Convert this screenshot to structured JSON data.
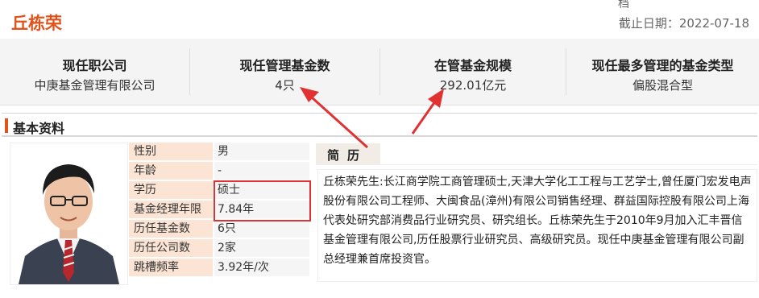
{
  "header": {
    "manager_name": "丘栋荣",
    "top_cut_text": "档",
    "cutoff_date": "截止日期：2022-07-18"
  },
  "stats": [
    {
      "title": "现任职公司",
      "value": "中庚基金管理有限公司"
    },
    {
      "title": "现任管理基金数",
      "value": "4只"
    },
    {
      "title": "在管基金规模",
      "value": "292.01亿元"
    },
    {
      "title": "现任最多管理的基金类型",
      "value": "偏股混合型"
    }
  ],
  "section": {
    "title": "基本资料"
  },
  "info": [
    {
      "key": "性别",
      "value": "男"
    },
    {
      "key": "年龄",
      "value": "-"
    },
    {
      "key": "学历",
      "value": "硕士"
    },
    {
      "key": "基金经理年限",
      "value": "7.84年"
    },
    {
      "key": "历任基金数",
      "value": "6只"
    },
    {
      "key": "历任公司数",
      "value": "2家"
    },
    {
      "key": "跳槽频率",
      "value": "3.92年/次"
    }
  ],
  "bio": {
    "tab_label": "简历",
    "text": "丘栋荣先生:长江商学院工商管理硕士,天津大学化工工程与工艺学士,曾任厦门宏发电声股份有限公司工程师、大闽食品(漳州)有限公司销售经理、群益国际控股有限公司上海代表处研究部消费品行业研究员、研究组长。丘栋荣先生于2010年9月加入汇丰晋信基金管理有限公司,历任股票行业研究员、高级研究员。现任中庚基金管理有限公司副总经理兼首席投资官。"
  },
  "colors": {
    "accent": "#e2531c",
    "annotation": "#e03232"
  }
}
